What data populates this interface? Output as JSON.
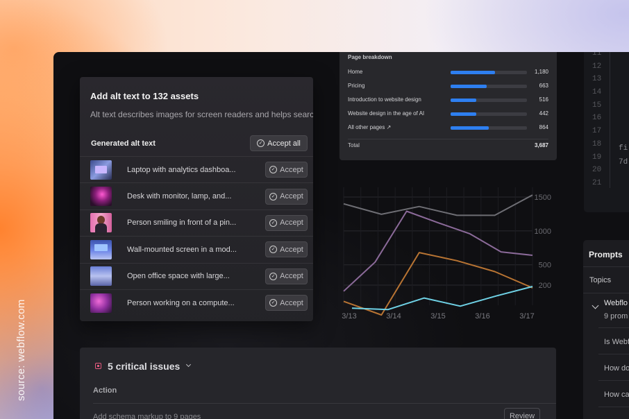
{
  "source_caption": "source: webflow.com",
  "alt_text_panel": {
    "title": "Add alt text to 132 assets",
    "description": "Alt text describes images for screen readers and helps search en",
    "generated_label": "Generated alt text",
    "accept_all_label": "Accept all",
    "accept_label": "Accept",
    "assets": [
      {
        "label": "Laptop with analytics dashboa..."
      },
      {
        "label": "Desk with monitor, lamp, and..."
      },
      {
        "label": "Person smiling in front of a pin..."
      },
      {
        "label": "Wall-mounted screen in a mod..."
      },
      {
        "label": "Open office space with large..."
      },
      {
        "label": "Person working on a compute..."
      }
    ]
  },
  "page_breakdown": {
    "title": "Page breakdown",
    "rows": [
      {
        "label": "Home",
        "value": "1,180",
        "fraction": 0.58
      },
      {
        "label": "Pricing",
        "value": "663",
        "fraction": 0.47
      },
      {
        "label": "Introduction to website design",
        "value": "516",
        "fraction": 0.34
      },
      {
        "label": "Website design in the age of AI",
        "value": "442",
        "fraction": 0.34
      },
      {
        "label": "All other pages ↗",
        "value": "864",
        "fraction": 0.5
      }
    ],
    "total_label": "Total",
    "total_value": "3,687",
    "bar_color": "#2e7ff0"
  },
  "chart_data": {
    "type": "line",
    "x": [
      "3/13",
      "3/14",
      "3/15",
      "3/16",
      "3/17"
    ],
    "yticks": [
      200,
      500,
      1000,
      1500
    ],
    "grid": true,
    "series": [
      {
        "color": "#6e6e74",
        "values": [
          1400,
          1245,
          1360,
          1230,
          1230,
          1530
        ]
      },
      {
        "color": "#8b6a99",
        "values": [
          110,
          540,
          1290,
          1120,
          960,
          690,
          640
        ]
      },
      {
        "color": "#b87433",
        "values": [
          -40,
          -240,
          680,
          560,
          400,
          160
        ]
      },
      {
        "color": "#6fd2e6",
        "values": [
          -140,
          -160,
          10,
          -110,
          40,
          180
        ]
      }
    ],
    "x_positions_note": "values sampled evenly across the plotted span"
  },
  "code_panel": {
    "line_numbers": [
      "11",
      "12",
      "13",
      "14",
      "15",
      "16",
      "17",
      "18",
      "19",
      "20",
      "21"
    ],
    "fragment_1": "fi",
    "fragment_2": "7d"
  },
  "prompts_panel": {
    "title": "Prompts",
    "topics_label": "Topics",
    "group_label": "Webflo",
    "group_sub": "9 prom",
    "items": [
      "Is Webf",
      "How do",
      "How ca"
    ]
  },
  "issues_panel": {
    "title": "5 critical issues",
    "column_header": "Action",
    "row_text": "Add schema markup to 9 pages",
    "review_label": "Review",
    "accent": "#e45a7f"
  }
}
